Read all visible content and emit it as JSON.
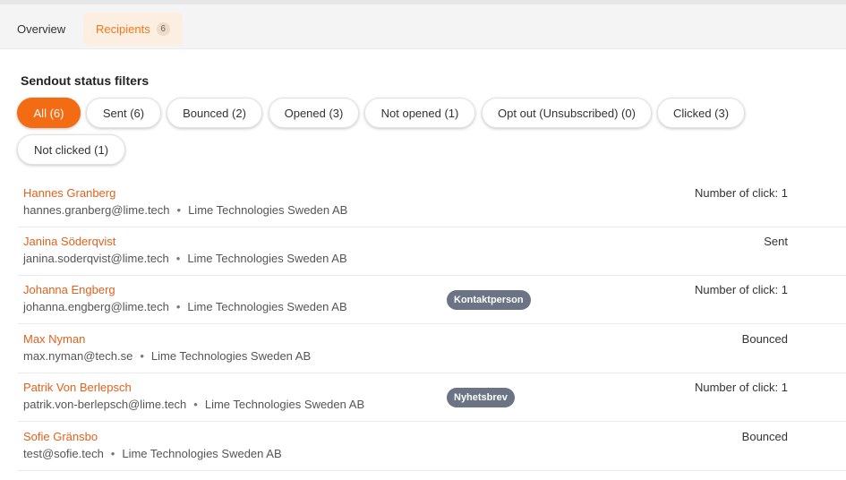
{
  "tabs": [
    {
      "label": "Overview"
    },
    {
      "label": "Recipients",
      "count": "6"
    }
  ],
  "filters": {
    "title": "Sendout status filters",
    "chips": [
      {
        "label": "All (6)",
        "active": true
      },
      {
        "label": "Sent (6)"
      },
      {
        "label": "Bounced (2)"
      },
      {
        "label": "Opened (3)"
      },
      {
        "label": "Not opened (1)"
      },
      {
        "label": "Opt out (Unsubscribed) (0)"
      },
      {
        "label": "Clicked (3)"
      },
      {
        "label": "Not clicked (1)"
      }
    ]
  },
  "recipients": [
    {
      "name": "Hannes Granberg",
      "email": "hannes.granberg@lime.tech",
      "company": "Lime Technologies Sweden AB",
      "status": "Number of click: 1",
      "tag": ""
    },
    {
      "name": "Janina Söderqvist",
      "email": "janina.soderqvist@lime.tech",
      "company": "Lime Technologies Sweden AB",
      "status": "Sent",
      "tag": ""
    },
    {
      "name": "Johanna Engberg",
      "email": "johanna.engberg@lime.tech",
      "company": "Lime Technologies Sweden AB",
      "status": "Number of click: 1",
      "tag": "Kontaktperson"
    },
    {
      "name": "Max Nyman",
      "email": "max.nyman@tech.se",
      "company": "Lime Technologies Sweden AB",
      "status": "Bounced",
      "tag": ""
    },
    {
      "name": "Patrik Von Berlepsch",
      "email": "patrik.von-berlepsch@lime.tech",
      "company": "Lime Technologies Sweden AB",
      "status": "Number of click: 1",
      "tag": "Nyhetsbrev"
    },
    {
      "name": "Sofie Gränsbo",
      "email": "test@sofie.tech",
      "company": "Lime Technologies Sweden AB",
      "status": "Bounced",
      "tag": ""
    }
  ],
  "colors": {
    "accent": "#f36b12",
    "link": "#e2611c",
    "tag_bg": "#6a7484"
  }
}
